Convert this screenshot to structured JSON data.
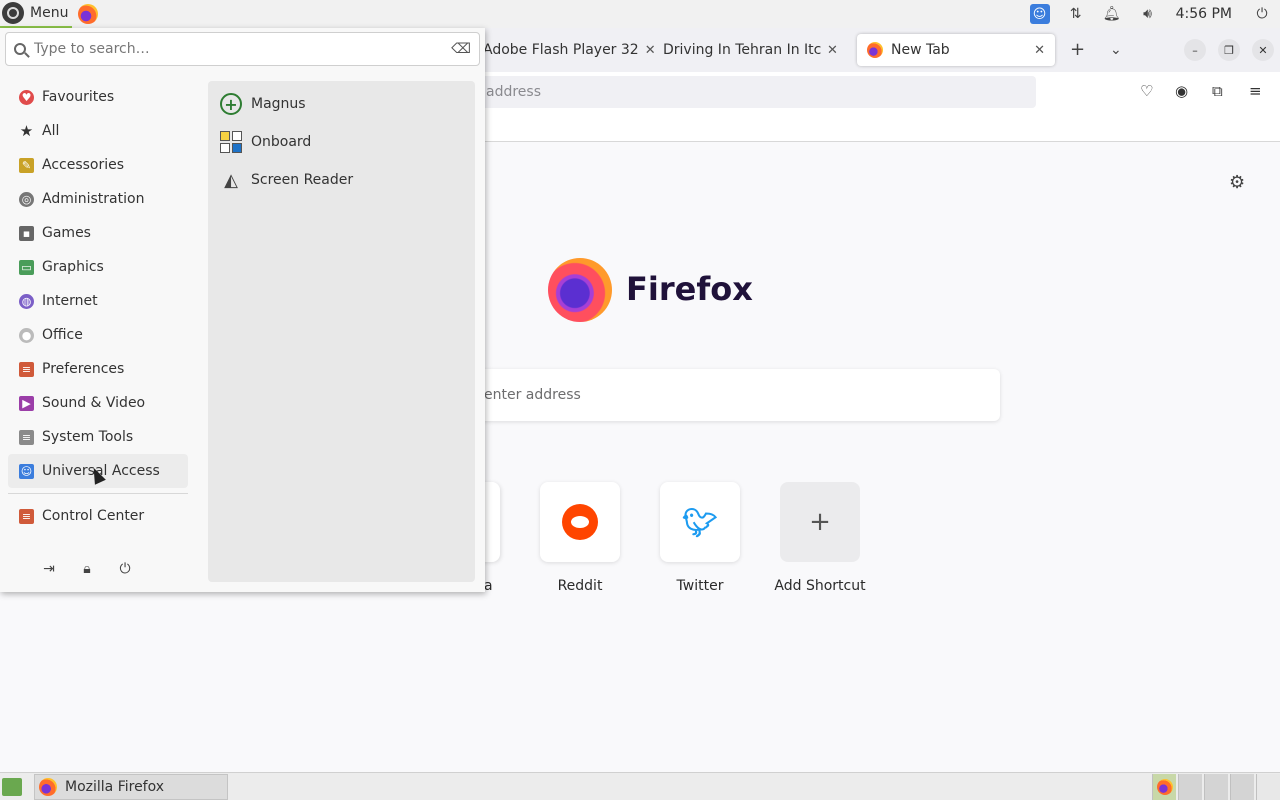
{
  "top_panel": {
    "menu_label": "Menu",
    "clock": "4:56 PM"
  },
  "firefox": {
    "tabs": [
      {
        "label": "Adobe Flash Player 32"
      },
      {
        "label": "Driving In Tehran In Itch.io"
      },
      {
        "label": "New Tab",
        "active": true
      }
    ],
    "url_placeholder": "address",
    "wordmark": "Firefox",
    "search_placeholder": "enter address",
    "shortcuts": [
      {
        "label": "a"
      },
      {
        "label": "Reddit"
      },
      {
        "label": "Twitter"
      },
      {
        "label": "Add Shortcut"
      }
    ]
  },
  "menu": {
    "search_placeholder": "Type to search…",
    "categories": [
      {
        "label": "Favourites",
        "color": "#e04b4b"
      },
      {
        "label": "All",
        "color": "#333333"
      },
      {
        "label": "Accessories",
        "color": "#c9a227"
      },
      {
        "label": "Administration",
        "color": "#777777"
      },
      {
        "label": "Games",
        "color": "#666666"
      },
      {
        "label": "Graphics",
        "color": "#4a9d5a"
      },
      {
        "label": "Internet",
        "color": "#7b5fc7"
      },
      {
        "label": "Office",
        "color": "#bbbbbb"
      },
      {
        "label": "Preferences",
        "color": "#d05a3a"
      },
      {
        "label": "Sound & Video",
        "color": "#9b3ea8"
      },
      {
        "label": "System Tools",
        "color": "#8a8a8a"
      },
      {
        "label": "Universal Access",
        "color": "#3b7ddd",
        "active": true
      }
    ],
    "control_center": "Control Center",
    "apps": [
      {
        "label": "Magnus"
      },
      {
        "label": "Onboard"
      },
      {
        "label": "Screen Reader"
      }
    ]
  },
  "taskbar": {
    "firefox_label": "Mozilla Firefox"
  }
}
